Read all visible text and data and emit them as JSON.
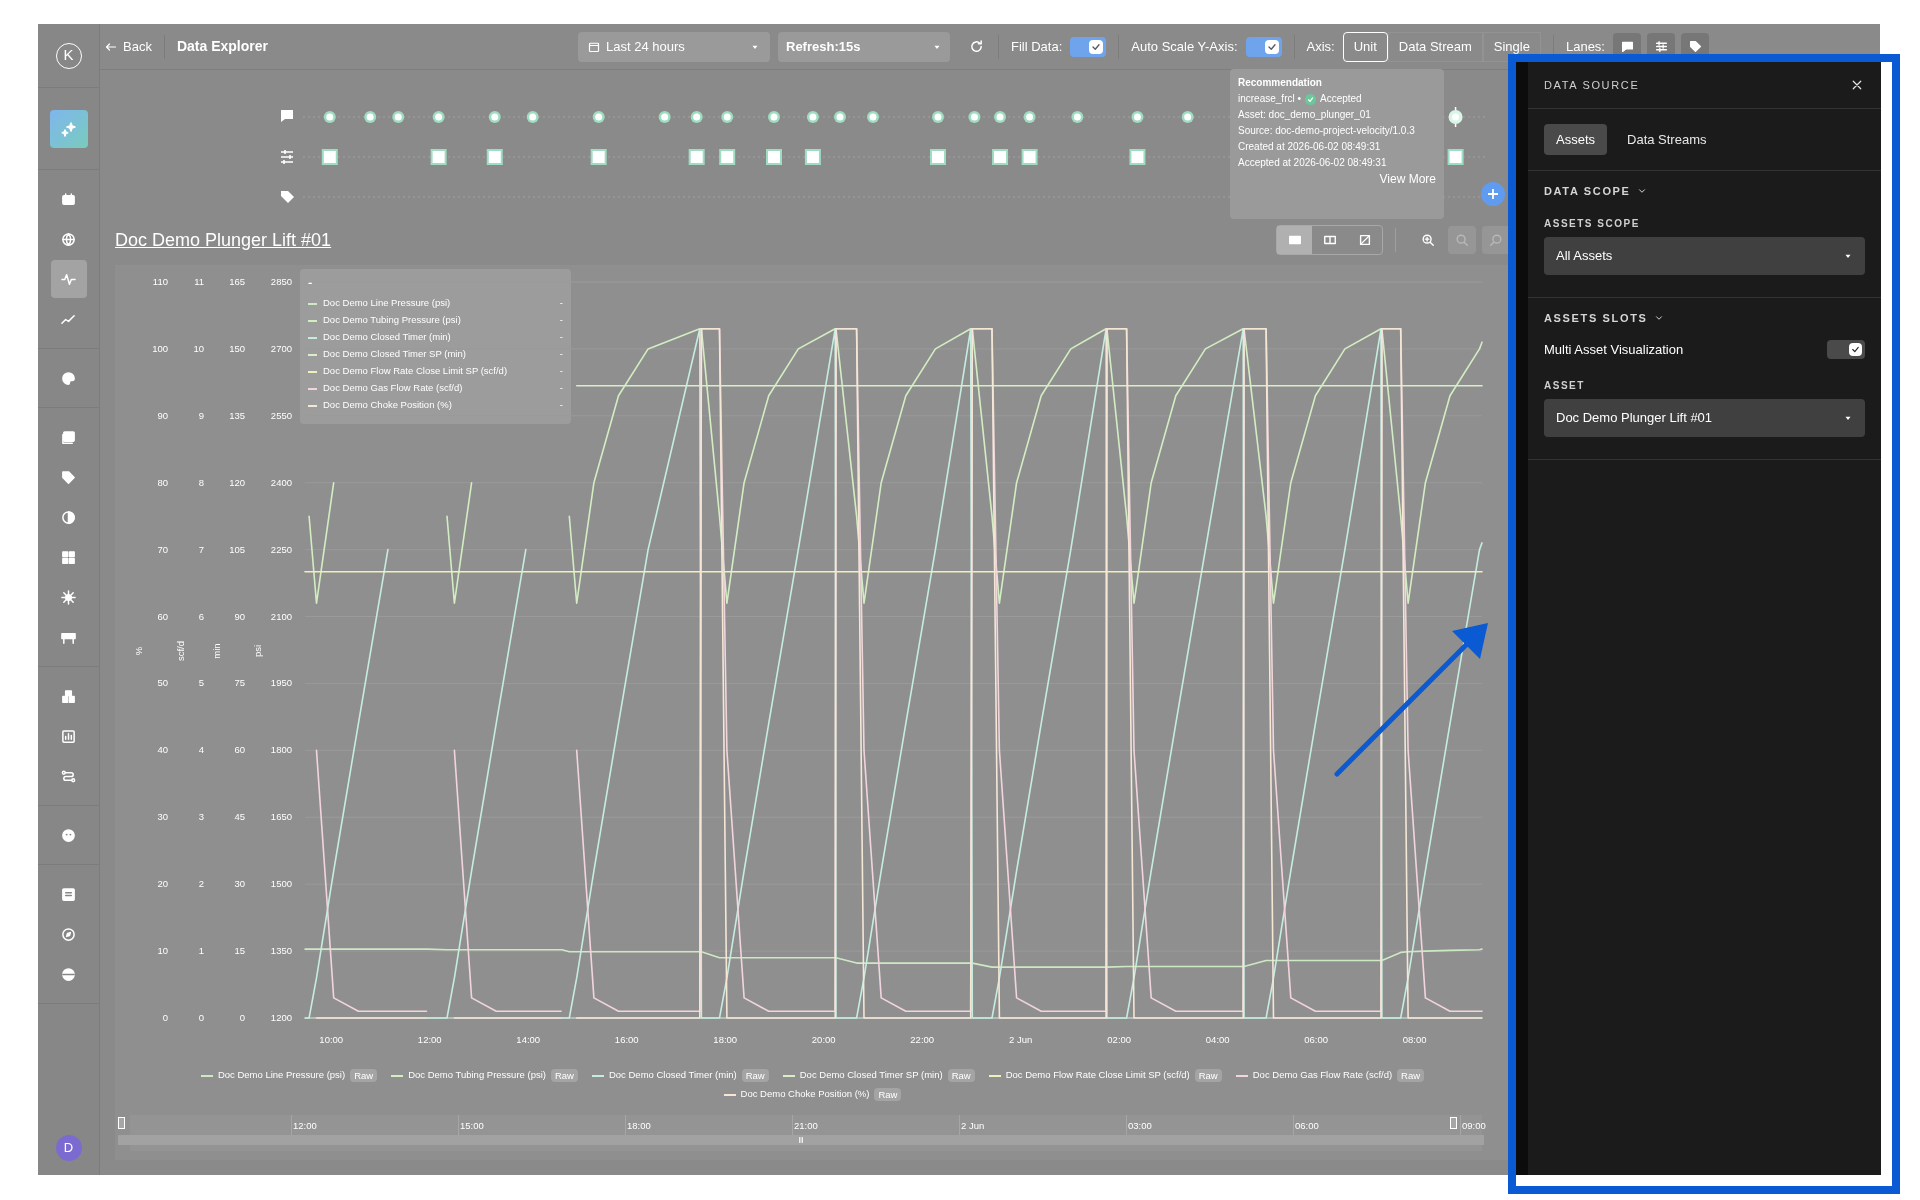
{
  "sidebar": {
    "logo": "K",
    "nav_groups": [
      {
        "items": [
          {
            "selected": false
          },
          {
            "selected": false
          },
          {
            "selected": true
          },
          {
            "selected": false
          }
        ]
      },
      {
        "items": [
          {
            "selected": false
          }
        ]
      },
      {
        "items": [
          {
            "selected": false
          },
          {
            "selected": false
          },
          {
            "selected": false
          },
          {
            "selected": false
          },
          {
            "selected": false
          },
          {
            "selected": false
          }
        ]
      },
      {
        "items": [
          {
            "selected": false
          },
          {
            "selected": false
          },
          {
            "selected": false
          }
        ]
      },
      {
        "items": [
          {
            "selected": false
          }
        ]
      },
      {
        "items": [
          {
            "selected": false
          },
          {
            "selected": false
          },
          {
            "selected": false
          }
        ]
      }
    ],
    "avatar": "D"
  },
  "top_bar": {
    "back": "Back",
    "title": "Data Explorer",
    "time_range": "Last 24 hours",
    "refresh": "Refresh:15s",
    "fill_data": {
      "label": "Fill Data:",
      "checked": true
    },
    "auto_scale": {
      "label": "Auto Scale Y-Axis:",
      "checked": true
    },
    "axis": {
      "label": "Axis:",
      "options": [
        {
          "label": "Unit",
          "selected": true
        },
        {
          "label": "Data Stream",
          "selected": false
        },
        {
          "label": "Single",
          "selected": false
        }
      ]
    },
    "lanes_label": "Lanes:"
  },
  "tooltip": {
    "title": "Recommendation",
    "name": "increase_frcl •",
    "status": "Accepted",
    "lines": [
      "Asset: doc_demo_plunger_01",
      "Source: doc-demo-project-velocity/1.0.3",
      "Created at 2026-06-02 08:49:31",
      "Accepted at 2026-06-02 08:49:31"
    ],
    "link": "View More"
  },
  "lanes": {
    "recommendations": [
      {
        "selected": false
      },
      {
        "selected": false
      },
      {
        "selected": false
      },
      {
        "selected": false
      },
      {
        "selected": false
      },
      {
        "selected": false
      },
      {
        "selected": false
      },
      {
        "selected": false
      },
      {
        "selected": false
      },
      {
        "selected": false
      },
      {
        "selected": false
      },
      {
        "selected": false
      },
      {
        "selected": false
      },
      {
        "selected": false
      },
      {
        "selected": false
      },
      {
        "selected": false
      },
      {
        "selected": false
      },
      {
        "selected": false
      },
      {
        "selected": false
      },
      {
        "selected": false
      },
      {
        "selected": false
      },
      {
        "selected": true
      }
    ],
    "setpoints": [
      {
        "selected": false
      },
      {
        "selected": false
      },
      {
        "selected": false
      },
      {
        "selected": false
      },
      {
        "selected": false
      },
      {
        "selected": false
      },
      {
        "selected": false
      },
      {
        "selected": false
      },
      {
        "selected": false
      },
      {
        "selected": false
      },
      {
        "selected": false
      },
      {
        "selected": false
      },
      {
        "selected": false
      }
    ]
  },
  "chart": {
    "title": "Doc Demo Plunger Lift #01",
    "view_modes": [
      {
        "selected": true
      },
      {
        "selected": false
      },
      {
        "selected": false
      }
    ],
    "zoom_tools": [
      {
        "disabled": false
      },
      {
        "disabled": true
      },
      {
        "disabled": true
      }
    ],
    "y_axes": [
      {
        "unit": "scf/d",
        "ticks": [
          "11",
          "10",
          "9",
          "8",
          "7",
          "6",
          "5",
          "4",
          "3",
          "2",
          "1",
          "0"
        ]
      },
      {
        "unit": "min",
        "ticks": [
          "165",
          "150",
          "135",
          "120",
          "105",
          "90",
          "75",
          "60",
          "45",
          "30",
          "15",
          "0"
        ]
      },
      {
        "unit": "psi",
        "ticks": [
          "2850",
          "2700",
          "2550",
          "2400",
          "2250",
          "2100",
          "1950",
          "1800",
          "1650",
          "1500",
          "1350",
          "1200"
        ]
      }
    ],
    "hover_legend": {
      "header": "-",
      "values": [
        "-",
        "-",
        "-",
        "-",
        "-",
        "-",
        "-"
      ]
    },
    "legend_tags": [
      "Raw",
      "Raw",
      "Raw",
      "Raw",
      "Raw",
      "Raw",
      "Raw"
    ],
    "navigator": {
      "labels": [
        "12:00",
        "15:00",
        "18:00",
        "21:00",
        "2 Jun",
        "03:00",
        "06:00",
        "09:00"
      ]
    },
    "chart_data": {
      "type": "line",
      "ylabel": "%",
      "grid": true,
      "xlim": [
        "2026-06-01T09:28",
        "2026-06-02T09:22"
      ],
      "ylim": [
        0,
        110
      ],
      "xticks": [
        {
          "value": "2026-06-01T10:00",
          "label": "10:00"
        },
        {
          "value": "2026-06-01T12:00",
          "label": "12:00"
        },
        {
          "value": "2026-06-01T14:00",
          "label": "14:00"
        },
        {
          "value": "2026-06-01T16:00",
          "label": "16:00"
        },
        {
          "value": "2026-06-01T18:00",
          "label": "18:00"
        },
        {
          "value": "2026-06-01T20:00",
          "label": "20:00"
        },
        {
          "value": "2026-06-01T22:00",
          "label": "22:00"
        },
        {
          "value": "2026-06-02T00:00",
          "label": "2 Jun"
        },
        {
          "value": "2026-06-02T02:00",
          "label": "02:00"
        },
        {
          "value": "2026-06-02T04:00",
          "label": "04:00"
        },
        {
          "value": "2026-06-02T06:00",
          "label": "06:00"
        },
        {
          "value": "2026-06-02T08:00",
          "label": "08:00"
        }
      ],
      "yticks": [
        0,
        10,
        20,
        30,
        40,
        50,
        60,
        70,
        80,
        90,
        100,
        110
      ],
      "x": [
        "2026-06-01T09:28",
        "2026-06-01T09:33",
        "2026-06-01T09:42",
        "2026-06-01T10:03",
        "2026-06-01T10:33",
        "2026-06-01T11:09",
        "2026-06-01T11:56",
        "2026-06-01T11:57",
        "2026-06-01T12:21",
        "2026-06-01T12:30",
        "2026-06-01T12:51",
        "2026-06-01T13:21",
        "2026-06-01T13:57",
        "2026-06-01T14:40",
        "2026-06-01T14:41",
        "2026-06-01T14:50",
        "2026-06-01T14:59",
        "2026-06-01T15:20",
        "2026-06-01T15:50",
        "2026-06-01T16:26",
        "2026-06-01T17:29",
        "2026-06-01T17:31",
        "2026-06-01T17:53",
        "2026-06-01T18:02",
        "2026-06-01T18:23",
        "2026-06-01T18:53",
        "2026-06-01T19:29",
        "2026-06-01T20:14",
        "2026-06-01T20:15",
        "2026-06-01T20:40",
        "2026-06-01T20:49",
        "2026-06-01T21:10",
        "2026-06-01T21:40",
        "2026-06-01T22:16",
        "2026-06-01T22:59",
        "2026-06-01T23:01",
        "2026-06-01T23:25",
        "2026-06-01T23:34",
        "2026-06-01T23:55",
        "2026-06-02T00:25",
        "2026-06-02T01:01",
        "2026-06-02T01:44",
        "2026-06-02T01:45",
        "2026-06-02T02:09",
        "2026-06-02T02:18",
        "2026-06-02T02:39",
        "2026-06-02T03:09",
        "2026-06-02T03:45",
        "2026-06-02T04:31",
        "2026-06-02T04:32",
        "2026-06-02T04:59",
        "2026-06-02T05:08",
        "2026-06-02T05:29",
        "2026-06-02T05:59",
        "2026-06-02T06:35",
        "2026-06-02T07:19",
        "2026-06-02T07:20",
        "2026-06-02T07:43",
        "2026-06-02T07:52",
        "2026-06-02T08:13",
        "2026-06-02T08:43",
        "2026-06-02T09:19",
        "2026-06-02T09:22"
      ],
      "series": [
        {
          "name": "Doc Demo Line Pressure (psi)",
          "color": "#cde9c4",
          "values": [
            10.3,
            10.3,
            10.3,
            10.3,
            10.3,
            10.3,
            10.3,
            10.3,
            10.2,
            10.2,
            10.2,
            10.2,
            10.2,
            10.2,
            10.2,
            9.9,
            9.9,
            9.9,
            9.9,
            9.9,
            9.9,
            9.9,
            9,
            9,
            9,
            9,
            9,
            9,
            9,
            8.2,
            8.2,
            8.2,
            8.2,
            8.2,
            8.2,
            8.2,
            7.6,
            7.6,
            7.6,
            7.6,
            7.6,
            7.6,
            7.6,
            7.7,
            7.7,
            7.7,
            7.7,
            7.7,
            7.7,
            7.7,
            8.6,
            8.6,
            8.6,
            8.6,
            8.6,
            8.6,
            8.6,
            9.8,
            9.9,
            10,
            10.1,
            10.2,
            10.3
          ]
        },
        {
          "name": "Doc Demo Tubing Pressure (psi)",
          "color": "#d3edc3",
          "values": [
            null,
            75,
            62,
            80,
            null,
            null,
            null,
            null,
            75,
            62,
            80,
            null,
            null,
            null,
            null,
            75,
            62,
            80,
            93,
            100,
            103,
            103,
            75,
            62,
            80,
            93,
            100,
            103,
            103,
            75,
            62,
            80,
            93,
            100,
            103,
            103,
            75,
            62,
            80,
            93,
            100,
            103,
            103,
            75,
            62,
            80,
            93,
            100,
            103,
            103,
            75,
            62,
            80,
            93,
            100,
            103,
            103,
            75,
            62,
            80,
            93,
            100,
            101
          ]
        },
        {
          "name": "Doc Demo Closed Timer (min)",
          "color": "#c6ece0",
          "values": [
            0,
            0,
            6,
            22,
            44,
            70,
            null,
            0,
            0,
            6,
            22,
            44,
            70,
            null,
            0,
            0,
            6,
            22,
            44,
            70,
            103,
            0,
            0,
            6,
            22,
            44,
            70,
            103,
            0,
            0,
            6,
            22,
            44,
            70,
            103,
            0,
            0,
            6,
            22,
            44,
            70,
            103,
            0,
            0,
            6,
            22,
            44,
            70,
            103,
            0,
            0,
            6,
            22,
            44,
            70,
            103,
            0,
            0,
            6,
            22,
            44,
            70,
            71
          ]
        },
        {
          "name": "Doc Demo Closed Timer SP (min)",
          "color": "#d8edc8",
          "values": [
            null,
            null,
            null,
            null,
            null,
            null,
            null,
            null,
            null,
            null,
            null,
            null,
            null,
            null,
            null,
            null,
            94.5,
            94.5,
            94.5,
            94.5,
            94.5,
            94.5,
            94.5,
            94.5,
            94.5,
            94.5,
            94.5,
            94.5,
            94.5,
            94.5,
            94.5,
            94.5,
            94.5,
            94.5,
            94.5,
            94.5,
            94.5,
            94.5,
            94.5,
            94.5,
            94.5,
            94.5,
            94.5,
            94.5,
            94.5,
            94.5,
            94.5,
            94.5,
            94.5,
            94.5,
            94.5,
            94.5,
            94.5,
            94.5,
            94.5,
            94.5,
            94.5,
            94.5,
            94.5,
            94.5,
            94.5,
            94.5,
            94.5
          ]
        },
        {
          "name": "Doc Demo Flow Rate Close Limit SP (scf/d)",
          "color": "#f0efbe",
          "values": [
            66.7,
            66.7,
            66.7,
            66.7,
            66.7,
            66.7,
            66.7,
            66.7,
            66.7,
            66.7,
            66.7,
            66.7,
            66.7,
            66.7,
            66.7,
            66.7,
            66.7,
            66.7,
            66.7,
            66.7,
            66.7,
            66.7,
            66.7,
            66.7,
            66.7,
            66.7,
            66.7,
            66.7,
            66.7,
            66.7,
            66.7,
            66.7,
            66.7,
            66.7,
            66.7,
            66.7,
            66.7,
            66.7,
            66.7,
            66.7,
            66.7,
            66.7,
            66.7,
            66.7,
            66.7,
            66.7,
            66.7,
            66.7,
            66.7,
            66.7,
            66.7,
            66.7,
            66.7,
            66.7,
            66.7,
            66.7,
            66.7,
            66.7,
            66.7,
            66.7,
            66.7,
            66.7,
            66.7
          ]
        },
        {
          "name": "Doc Demo Gas Flow Rate (scf/d)",
          "color": "#f2d4dc",
          "values": [
            null,
            null,
            40,
            3,
            1,
            1,
            1,
            null,
            null,
            40,
            3,
            1,
            1,
            1,
            null,
            null,
            40,
            3,
            1,
            1,
            1,
            103,
            103,
            40,
            3,
            1,
            1,
            1,
            103,
            103,
            40,
            3,
            1,
            1,
            1,
            103,
            103,
            40,
            3,
            1,
            1,
            1,
            103,
            103,
            40,
            3,
            1,
            1,
            1,
            103,
            103,
            40,
            3,
            1,
            1,
            1,
            103,
            103,
            40,
            3,
            1,
            1,
            1
          ]
        },
        {
          "name": "Doc Demo Choke Position (%)",
          "color": "#f5e6d6",
          "values": [
            null,
            null,
            0,
            0,
            0,
            0,
            0,
            null,
            null,
            0,
            0,
            0,
            0,
            0,
            null,
            null,
            0,
            0,
            0,
            0,
            0,
            103,
            103,
            0,
            0,
            0,
            0,
            0,
            103,
            103,
            0,
            0,
            0,
            0,
            0,
            103,
            103,
            0,
            0,
            0,
            0,
            0,
            103,
            103,
            0,
            0,
            0,
            0,
            0,
            103,
            103,
            0,
            0,
            0,
            0,
            0,
            103,
            103,
            0,
            0,
            0,
            0,
            0
          ]
        }
      ]
    }
  },
  "panel": {
    "title": "DATA SOURCE",
    "tabs": [
      {
        "label": "Assets",
        "selected": true
      },
      {
        "label": "Data Streams",
        "selected": false
      }
    ],
    "data_scope": {
      "title": "DATA SCOPE",
      "expanded": true,
      "field_label": "ASSETS SCOPE",
      "value": "All Assets"
    },
    "asset_slots": {
      "title": "ASSETS SLOTS",
      "expanded": true,
      "toggle": {
        "label": "Multi Asset Visualization",
        "checked": true
      },
      "field_label": "ASSET",
      "value": "Doc Demo Plunger Lift #01"
    }
  }
}
